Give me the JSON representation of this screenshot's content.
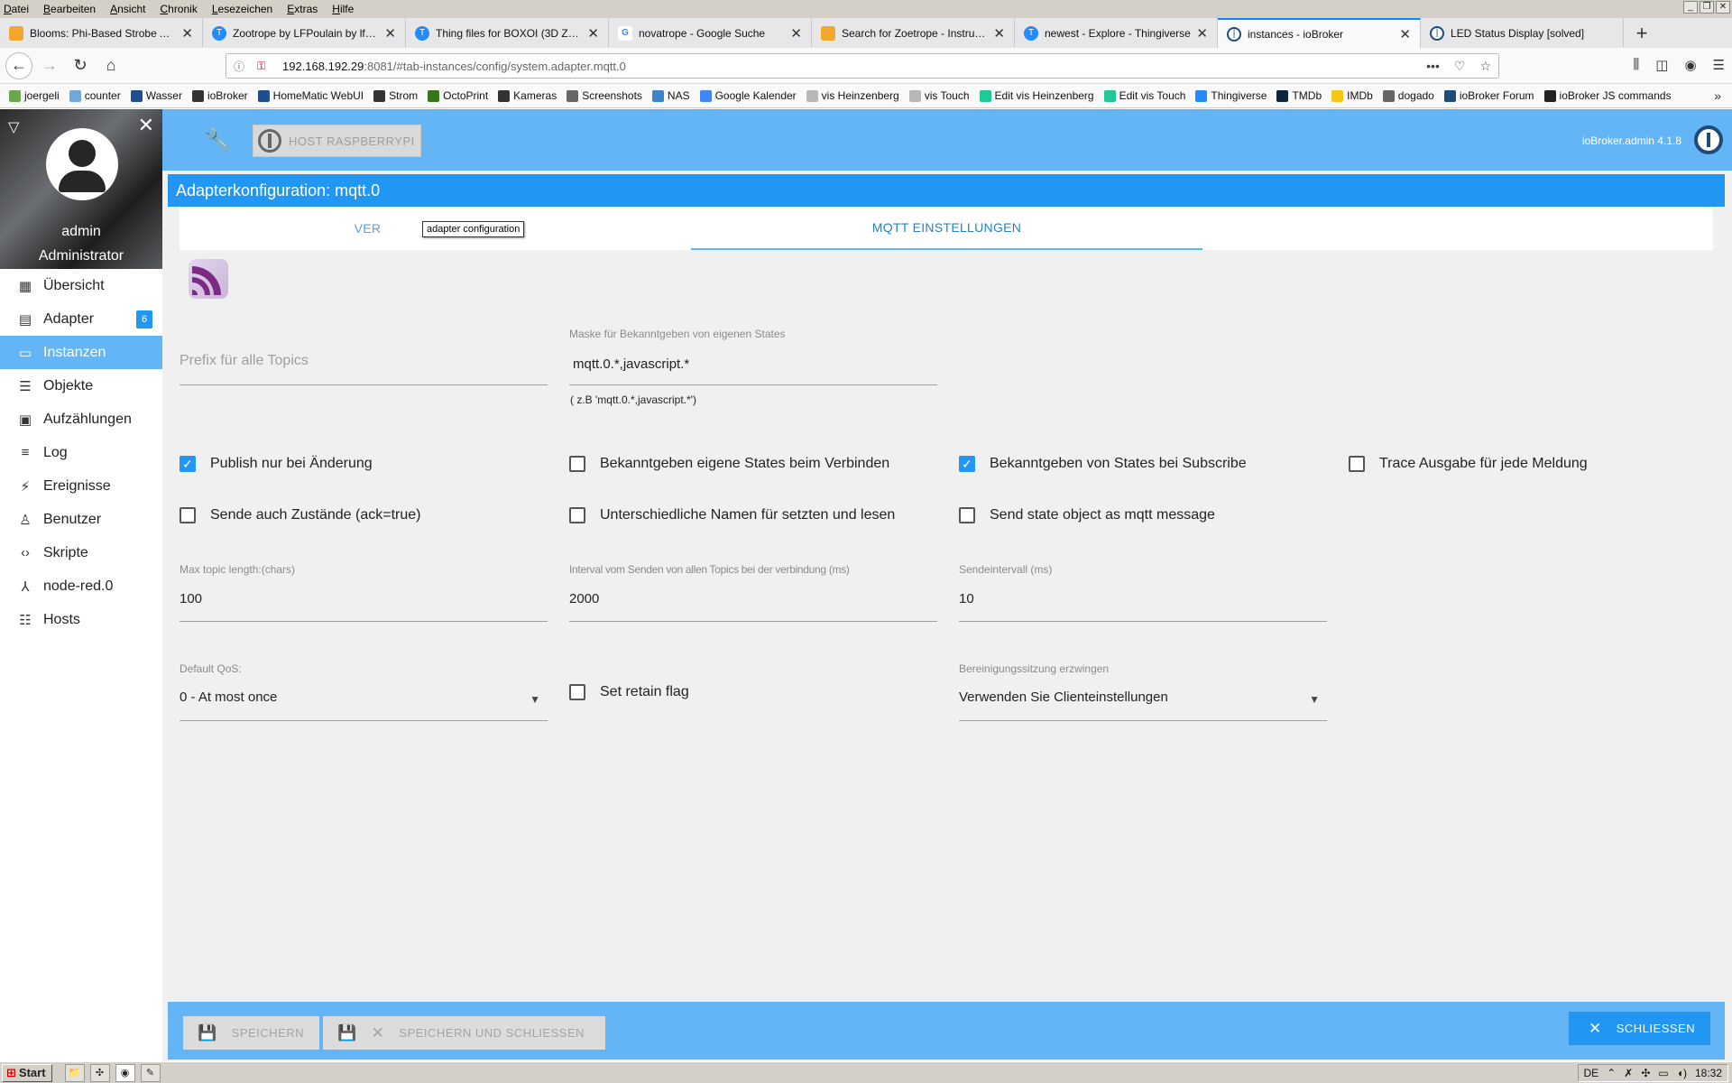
{
  "menubar": {
    "items": [
      "Datei",
      "Bearbeiten",
      "Ansicht",
      "Chronik",
      "Lesezeichen",
      "Extras",
      "Hilfe"
    ]
  },
  "tabs": [
    {
      "label": "Blooms: Phi-Based Strobe Animation",
      "icon": "instructables-icon",
      "color": "#f2a62b"
    },
    {
      "label": "Zootrope by LFPoulain by lfpoulain",
      "icon": "thingiverse-icon",
      "color": "#248bfb"
    },
    {
      "label": "Thing files for BOXOI (3D Zoetrope)",
      "icon": "thingiverse-icon",
      "color": "#248bfb"
    },
    {
      "label": "novatrope - Google Suche",
      "icon": "google-icon",
      "color": "#ffffff"
    },
    {
      "label": "Search for Zoetrope - Instructables",
      "icon": "instructables-icon",
      "color": "#f2a62b"
    },
    {
      "label": "newest - Explore - Thingiverse",
      "icon": "thingiverse-icon",
      "color": "#248bfb"
    },
    {
      "label": "instances - ioBroker",
      "icon": "iobroker-icon",
      "color": "#1f4b7a",
      "active": true
    },
    {
      "label": "LED Status Display [solved]",
      "icon": "iobroker-icon",
      "color": "#1f4b7a"
    }
  ],
  "url": {
    "host": "192.168.192.29",
    "path": ":8081/#tab-instances/config/system.adapter.mqtt.0"
  },
  "bookmarks": [
    {
      "label": "joergeli",
      "color": "#6aa84f"
    },
    {
      "label": "counter",
      "color": "#6fa8dc"
    },
    {
      "label": "Wasser",
      "color": "#1f4e8c"
    },
    {
      "label": "ioBroker",
      "color": "#333333"
    },
    {
      "label": "HomeMatic WebUI",
      "color": "#1f4e8c"
    },
    {
      "label": "Strom",
      "color": "#333333"
    },
    {
      "label": "OctoPrint",
      "color": "#38761d"
    },
    {
      "label": "Kameras",
      "color": "#333333"
    },
    {
      "label": "Screenshots",
      "color": "#666666"
    },
    {
      "label": "NAS",
      "color": "#3d85c6"
    },
    {
      "label": "Google Kalender",
      "color": "#4285f4"
    },
    {
      "label": "vis Heinzenberg",
      "color": "#b7b7b7"
    },
    {
      "label": "vis Touch",
      "color": "#b7b7b7"
    },
    {
      "label": "Edit vis Heinzenberg",
      "color": "#20c997"
    },
    {
      "label": "Edit vis Touch",
      "color": "#20c997"
    },
    {
      "label": "Thingiverse",
      "color": "#248bfb"
    },
    {
      "label": "TMDb",
      "color": "#0d253f"
    },
    {
      "label": "IMDb",
      "color": "#f5c518"
    },
    {
      "label": "dogado",
      "color": "#666666"
    },
    {
      "label": "ioBroker Forum",
      "color": "#1f4b7a"
    },
    {
      "label": "ioBroker JS commands",
      "color": "#222222"
    }
  ],
  "sidebar": {
    "user": "admin",
    "role": "Administrator",
    "items": [
      {
        "label": "Übersicht",
        "icon": "grid-icon",
        "glyph": "▦"
      },
      {
        "label": "Adapter",
        "icon": "store-icon",
        "glyph": "▤",
        "badge": "6"
      },
      {
        "label": "Instanzen",
        "icon": "instances-icon",
        "glyph": "▭",
        "active": true
      },
      {
        "label": "Objekte",
        "icon": "list-icon",
        "glyph": "☰"
      },
      {
        "label": "Aufzählungen",
        "icon": "enum-icon",
        "glyph": "▣"
      },
      {
        "label": "Log",
        "icon": "log-icon",
        "glyph": "≡"
      },
      {
        "label": "Ereignisse",
        "icon": "flash-icon",
        "glyph": "⚡"
      },
      {
        "label": "Benutzer",
        "icon": "user-icon",
        "glyph": "♙"
      },
      {
        "label": "Skripte",
        "icon": "code-icon",
        "glyph": "‹›"
      },
      {
        "label": "node-red.0",
        "icon": "node-red-icon",
        "glyph": "⅄"
      },
      {
        "label": "Hosts",
        "icon": "hosts-icon",
        "glyph": "☷"
      }
    ]
  },
  "appbar": {
    "host_button": "HOST RASPBERRYPI",
    "version": "ioBroker.admin 4.1.8"
  },
  "config": {
    "title": "Adapterkonfiguration: mqtt.0",
    "tab1": "VER",
    "tab2": "MQTT EINSTELLUNGEN",
    "tooltip": "adapter configuration"
  },
  "form": {
    "prefix_placeholder": "Prefix für alle Topics",
    "mask_label": "Maske für Bekanntgeben von eigenen States",
    "mask_value": "mqtt.0.*,javascript.*",
    "mask_hint": "( z.B 'mqtt.0.*,javascript.*')",
    "checkboxes": [
      {
        "label": "Publish nur bei Änderung",
        "checked": true
      },
      {
        "label": "Bekanntgeben eigene States beim Verbinden",
        "checked": false
      },
      {
        "label": "Bekanntgeben von States bei Subscribe",
        "checked": true
      },
      {
        "label": "Trace Ausgabe für jede Meldung",
        "checked": false
      },
      {
        "label": "Sende auch Zustände (ack=true)",
        "checked": false
      },
      {
        "label": "Unterschiedliche Namen für setzten und lesen",
        "checked": false
      },
      {
        "label": "Send state object as mqtt message",
        "checked": false
      }
    ],
    "max_topic_label": "Max topic length:(chars)",
    "max_topic_value": "100",
    "interval_label": "Interval vom Senden von allen Topics bei der verbindung (ms)",
    "interval_value": "2000",
    "send_interval_label": "Sendeintervall (ms)",
    "send_interval_value": "10",
    "qos_label": "Default QoS:",
    "qos_value": "0 - At most once",
    "retain_label": "Set retain flag",
    "retain_checked": false,
    "clean_label": "Bereinigungssitzung erzwingen",
    "clean_value": "Verwenden Sie Clienteinstellungen"
  },
  "footer": {
    "save": "SPEICHERN",
    "save_close": "SPEICHERN UND SCHLIESSEN",
    "close": "SCHLIESSEN"
  },
  "taskbar": {
    "start": "Start",
    "lang": "DE",
    "time": "18:32"
  }
}
